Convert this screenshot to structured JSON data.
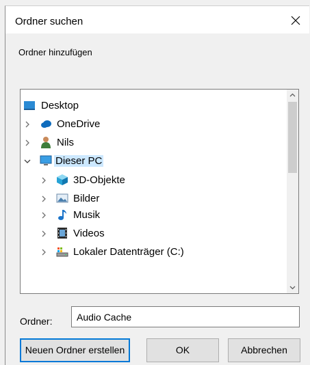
{
  "dialog": {
    "title": "Ordner suchen",
    "description": "Ordner hinzufügen"
  },
  "tree": {
    "items": [
      {
        "label": "Desktop",
        "icon": "desktop-icon",
        "expander": "none",
        "selected": false
      },
      {
        "label": "OneDrive",
        "icon": "cloud-icon",
        "expander": "collapsed",
        "selected": false
      },
      {
        "label": "Nils",
        "icon": "user-icon",
        "expander": "collapsed",
        "selected": false
      },
      {
        "label": "Dieser PC",
        "icon": "computer-icon",
        "expander": "expanded",
        "selected": true
      },
      {
        "label": "3D-Objekte",
        "icon": "cube-icon",
        "expander": "collapsed",
        "selected": false
      },
      {
        "label": "Bilder",
        "icon": "pictures-icon",
        "expander": "collapsed",
        "selected": false
      },
      {
        "label": "Musik",
        "icon": "music-icon",
        "expander": "collapsed",
        "selected": false
      },
      {
        "label": "Videos",
        "icon": "film-icon",
        "expander": "collapsed",
        "selected": false
      },
      {
        "label": "Lokaler Datenträger (C:)",
        "icon": "drive-icon",
        "expander": "collapsed",
        "selected": false
      }
    ]
  },
  "folder": {
    "label": "Ordner:",
    "value": "Audio Cache"
  },
  "buttons": {
    "new_folder": "Neuen Ordner erstellen",
    "ok": "OK",
    "cancel": "Abbrechen"
  },
  "colors": {
    "selection": "#cce8ff",
    "focus_border": "#0078d7",
    "dialog_bg": "#f0f0f0"
  }
}
